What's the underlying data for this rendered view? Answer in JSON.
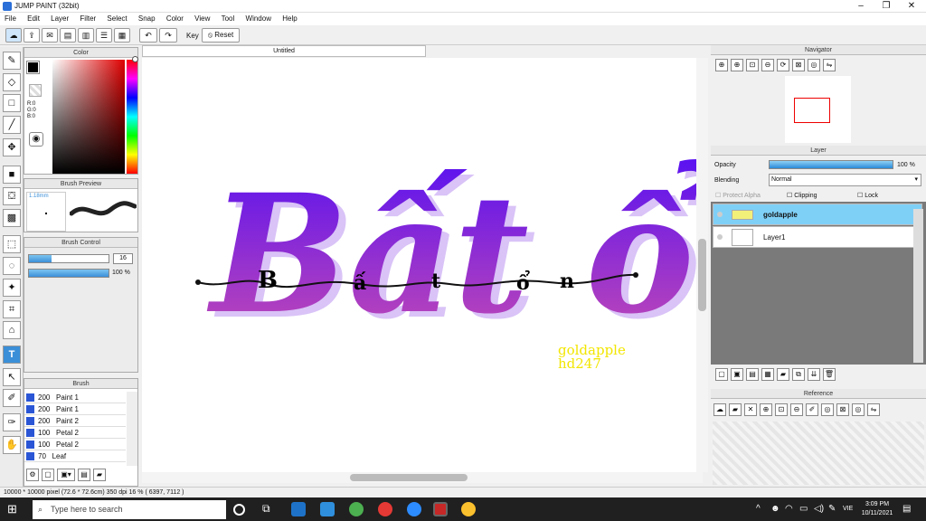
{
  "app": {
    "title": "JUMP PAINT (32bit)"
  },
  "menu": [
    "File",
    "Edit",
    "Layer",
    "Filter",
    "Select",
    "Snap",
    "Color",
    "View",
    "Tool",
    "Window",
    "Help"
  ],
  "toolbar": {
    "key_label": "Key",
    "reset_label": "Reset"
  },
  "panels": {
    "color": {
      "title": "Color",
      "rgb_r": "R:0",
      "rgb_g": "G:0",
      "rgb_b": "B:0"
    },
    "brush_preview": {
      "title": "Brush Preview",
      "size_text": "1.18mm"
    },
    "brush_control": {
      "title": "Brush Control",
      "size_value": "16",
      "opacity_value": "100 %",
      "size_fraction": 0.28,
      "opacity_fraction": 1.0
    },
    "brush": {
      "title": "Brush",
      "items": [
        {
          "size": "200",
          "name": "Paint 1"
        },
        {
          "size": "200",
          "name": "Paint 1"
        },
        {
          "size": "200",
          "name": "Paint 2"
        },
        {
          "size": "100",
          "name": "Petal 2"
        },
        {
          "size": "100",
          "name": "Petal 2"
        },
        {
          "size": "70",
          "name": "Leaf"
        }
      ]
    },
    "navigator": {
      "title": "Navigator"
    },
    "layer": {
      "title": "Layer",
      "opacity_label": "Opacity",
      "opacity_value": "100 %",
      "opacity_fraction": 1.0,
      "blending_label": "Blending",
      "blending_value": "Normal",
      "protect_alpha": "Protect Alpha",
      "clipping": "Clipping",
      "lock": "Lock",
      "layers": [
        {
          "name": "goldapple",
          "selected": true
        },
        {
          "name": "Layer1",
          "selected": false
        }
      ]
    },
    "reference": {
      "title": "Reference"
    }
  },
  "document": {
    "tab_title": "Untitled"
  },
  "artwork": {
    "main_text": "Bất ổn",
    "overlay_letters": [
      "B",
      "ấ",
      "t",
      "ổ",
      "n"
    ],
    "watermark_line1": "goldapple",
    "watermark_line2": "hd247"
  },
  "status": {
    "text": "10000 * 10000 pixel  (72.6 * 72.6cm)  350 dpi  16 %  ( 6397, 7112 )"
  },
  "taskbar": {
    "search_placeholder": "Type here to search",
    "time": "3:09 PM",
    "date": "10/11/2021",
    "lang": "VIE"
  },
  "colors": {
    "accent": "#3b8fd8",
    "primary_color": "#000000",
    "secondary_color": "#1a1ad6"
  }
}
